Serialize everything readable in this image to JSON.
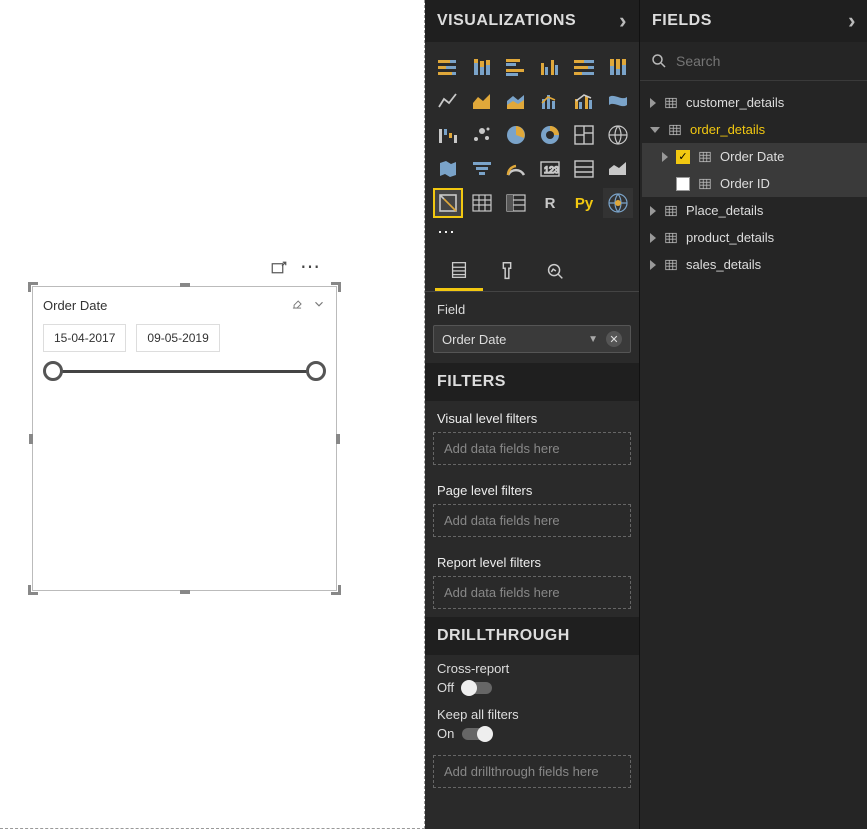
{
  "canvas": {
    "visual_title": "Order Date",
    "date_start": "15-04-2017",
    "date_end": "09-05-2019"
  },
  "viz_pane": {
    "title": "VISUALIZATIONS",
    "field_label": "Field",
    "field_chip": "Order Date",
    "filters_header": "FILTERS",
    "filter_groups": {
      "visual": "Visual level filters",
      "page": "Page level filters",
      "report": "Report level filters"
    },
    "drop_placeholder": "Add data fields here",
    "drill_header": "DRILLTHROUGH",
    "cross_report_label": "Cross-report",
    "cross_report_state": "Off",
    "keep_filters_label": "Keep all filters",
    "keep_filters_state": "On",
    "drill_drop_placeholder": "Add drillthrough fields here"
  },
  "fields_pane": {
    "title": "FIELDS",
    "search_placeholder": "Search",
    "tables": [
      {
        "name": "customer_details",
        "expanded": false,
        "active": false
      },
      {
        "name": "order_details",
        "expanded": true,
        "active": true,
        "fields": [
          {
            "name": "Order Date",
            "checked": true,
            "expandable": true
          },
          {
            "name": "Order ID",
            "checked": false,
            "expandable": false
          }
        ]
      },
      {
        "name": "Place_details",
        "expanded": false,
        "active": false
      },
      {
        "name": "product_details",
        "expanded": false,
        "active": false
      },
      {
        "name": "sales_details",
        "expanded": false,
        "active": false
      }
    ]
  }
}
